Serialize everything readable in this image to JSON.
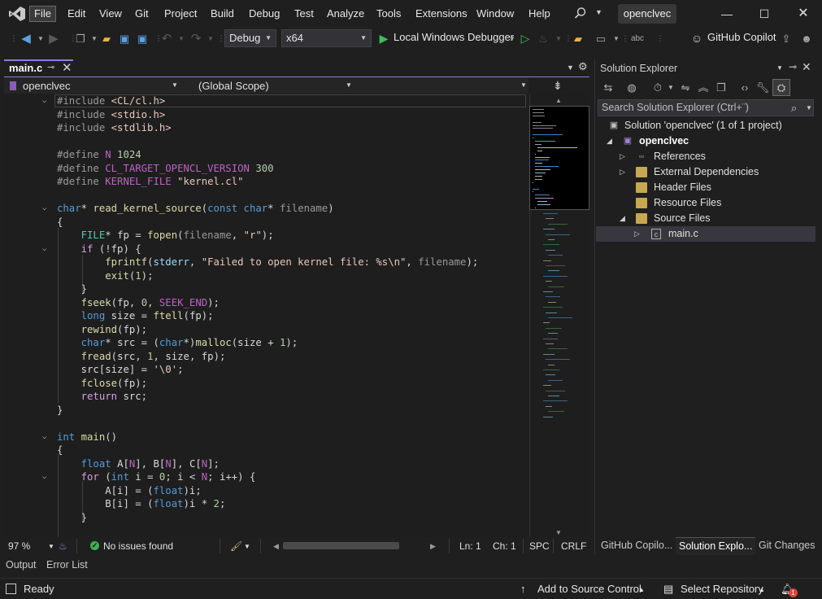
{
  "menubar": {
    "items": [
      {
        "label": "File",
        "active": true
      },
      {
        "label": "Edit"
      },
      {
        "label": "View"
      },
      {
        "label": "Git"
      },
      {
        "label": "Project"
      },
      {
        "label": "Build"
      },
      {
        "label": "Debug"
      },
      {
        "label": "Test"
      },
      {
        "label": "Analyze"
      },
      {
        "label": "Tools"
      },
      {
        "label": "Extensions"
      },
      {
        "label": "Window"
      },
      {
        "label": "Help"
      }
    ],
    "solution_name": "openclvec",
    "window_controls": [
      "minimize-icon",
      "maximize-icon",
      "close-icon"
    ]
  },
  "toolbar": {
    "configuration": "Debug",
    "platform": "x64",
    "debugger": "Local Windows Debugger",
    "copilot": "GitHub Copilot"
  },
  "editor": {
    "tab_label": "main.c",
    "nav_project": "openclvec",
    "nav_scope": "(Global Scope)",
    "nav_member": "",
    "lines": [
      "#include <CL/cl.h>",
      "#include <stdio.h>",
      "#include <stdlib.h>",
      "",
      "#define N 1024",
      "#define CL_TARGET_OPENCL_VERSION 300",
      "#define KERNEL_FILE \"kernel.cl\"",
      "",
      "char* read_kernel_source(const char* filename)",
      "{",
      "    FILE* fp = fopen(filename, \"r\");",
      "    if (!fp) {",
      "        fprintf(stderr, \"Failed to open kernel file: %s\\n\", filename);",
      "        exit(1);",
      "    }",
      "    fseek(fp, 0, SEEK_END);",
      "    long size = ftell(fp);",
      "    rewind(fp);",
      "    char* src = (char*)malloc(size + 1);",
      "    fread(src, 1, size, fp);",
      "    src[size] = '\\0';",
      "    fclose(fp);",
      "    return src;",
      "}",
      "",
      "int main()",
      "{",
      "    float A[N], B[N], C[N];",
      "    for (int i = 0; i < N; i++) {",
      "        A[i] = (float)i;",
      "        B[i] = (float)i * 2;",
      "    }"
    ],
    "status": {
      "zoom": "97 %",
      "issues": "No issues found",
      "line": "Ln: 1",
      "col": "Ch: 1",
      "whitespace": "SPC",
      "line_ending": "CRLF"
    }
  },
  "bottom_tabs": [
    "Output",
    "Error List"
  ],
  "statusbar": {
    "ready": "Ready",
    "source_control": "Add to Source Control",
    "repository": "Select Repository",
    "notification_count": "1"
  },
  "solution_explorer": {
    "title": "Solution Explorer",
    "search_placeholder": "Search Solution Explorer (Ctrl+¨)",
    "tree": [
      {
        "label": "Solution 'openclvec' (1 of 1 project)",
        "level": 0,
        "icon": "solution-icon"
      },
      {
        "label": "openclvec",
        "level": 1,
        "icon": "project-icon",
        "bold": true
      },
      {
        "label": "References",
        "level": 2,
        "icon": "references-icon"
      },
      {
        "label": "External Dependencies",
        "level": 2,
        "icon": "external-dependencies-icon"
      },
      {
        "label": "Header Files",
        "level": 2,
        "icon": "folder-icon"
      },
      {
        "label": "Resource Files",
        "level": 2,
        "icon": "folder-icon"
      },
      {
        "label": "Source Files",
        "level": 2,
        "icon": "folder-icon"
      },
      {
        "label": "main.c",
        "level": 3,
        "icon": "c-file-icon",
        "selected": true
      }
    ],
    "bottom_tabs": [
      {
        "label": "GitHub Copilo..."
      },
      {
        "label": "Solution Explo...",
        "active": true
      },
      {
        "label": "Git Changes"
      }
    ]
  },
  "colors": {
    "accent": "#8b7ce0",
    "background": "#1f1f1f",
    "editor_bg": "#1e1e1e",
    "keyword": "#569cd6",
    "function": "#dcdcaa",
    "string": "#e8c9bb",
    "macro": "#bd63c5",
    "number": "#b5cea8"
  }
}
